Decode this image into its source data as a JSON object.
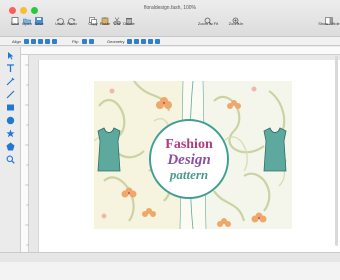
{
  "window": {
    "title": "floraldesign.fash, 100%"
  },
  "colors": {
    "close": "#fc5f57",
    "minimize": "#fdbc2e",
    "zoom": "#28c840",
    "accent": "#1f78d1"
  },
  "toolbar": {
    "left": [
      {
        "label": "New",
        "icon": "new-document-icon"
      },
      {
        "label": "Open",
        "icon": "folder-icon"
      },
      {
        "label": "Save",
        "icon": "save-icon"
      },
      {
        "label": "Undo",
        "icon": "undo-icon"
      },
      {
        "label": "Redo",
        "icon": "redo-icon"
      },
      {
        "label": "Copy",
        "icon": "copy-icon"
      },
      {
        "label": "Paste",
        "icon": "paste-icon"
      },
      {
        "label": "Cut",
        "icon": "scissors-icon"
      },
      {
        "label": "Delete",
        "icon": "trash-icon"
      }
    ],
    "right": [
      {
        "label": "Zoom to Fit",
        "icon": "zoom-fit-icon"
      },
      {
        "label": "Zoom In",
        "icon": "zoom-in-icon"
      },
      {
        "label": "Show / Hide",
        "icon": "show-hide-icon"
      }
    ]
  },
  "formatbar": {
    "align": "Align",
    "flip": "Flip",
    "geometry": "Geometry"
  },
  "tools": [
    "pointer-icon",
    "text-icon",
    "pen-icon",
    "line-icon",
    "rectangle-icon",
    "ellipse-icon",
    "star-icon",
    "polygon-icon",
    "magnify-icon"
  ],
  "artwork": {
    "line1": "Fashion",
    "line2": "Design",
    "line3": "pattern"
  }
}
